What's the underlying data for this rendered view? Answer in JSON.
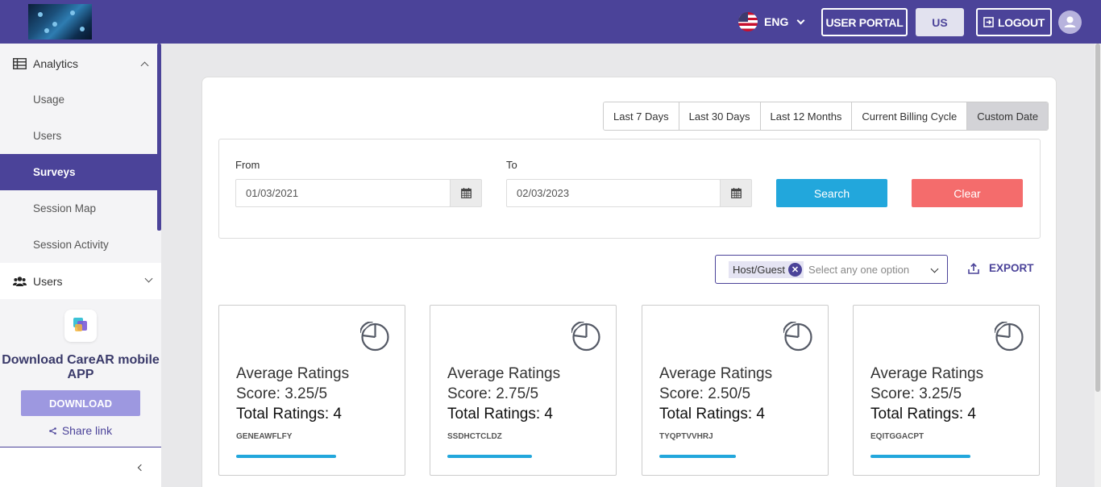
{
  "header": {
    "language": "ENG",
    "user_portal_label": "USER PORTAL",
    "region_label": "US",
    "logout_label": "LOGOUT"
  },
  "sidebar": {
    "analytics_label": "Analytics",
    "items": [
      {
        "label": "Usage"
      },
      {
        "label": "Users"
      },
      {
        "label": "Surveys"
      },
      {
        "label": "Session Map"
      },
      {
        "label": "Session Activity"
      }
    ],
    "users_label": "Users",
    "promo": {
      "title": "Download CareAR mobile APP",
      "download_label": "DOWNLOAD",
      "share_label": "Share link"
    }
  },
  "date_ranges": [
    {
      "label": "Last 7 Days"
    },
    {
      "label": "Last 30 Days"
    },
    {
      "label": "Last 12 Months"
    },
    {
      "label": "Current Billing Cycle"
    },
    {
      "label": "Custom Date"
    }
  ],
  "filters": {
    "from_label": "From",
    "from_value": "01/03/2021",
    "to_label": "To",
    "to_value": "02/03/2023",
    "search_label": "Search",
    "clear_label": "Clear"
  },
  "selector": {
    "chip_label": "Host/Guest",
    "placeholder": "Select any one option"
  },
  "export_label": "EXPORT",
  "stats": [
    {
      "title": "Average Ratings",
      "score": "Score: 3.25/5",
      "total": "Total Ratings: 4",
      "code": "GENEAWFLFY",
      "progress": 0.65
    },
    {
      "title": "Average Ratings",
      "score": "Score: 2.75/5",
      "total": "Total Ratings: 4",
      "code": "SSDHCTCLDZ",
      "progress": 0.55
    },
    {
      "title": "Average Ratings",
      "score": "Score: 2.50/5",
      "total": "Total Ratings: 4",
      "code": "TYQPTVVHRJ",
      "progress": 0.5
    },
    {
      "title": "Average Ratings",
      "score": "Score: 3.25/5",
      "total": "Total Ratings: 4",
      "code": "EQITGGACPT",
      "progress": 0.65
    }
  ],
  "colors": {
    "brand": "#4b4399",
    "search": "#22a7dc",
    "clear": "#f46c6c"
  }
}
